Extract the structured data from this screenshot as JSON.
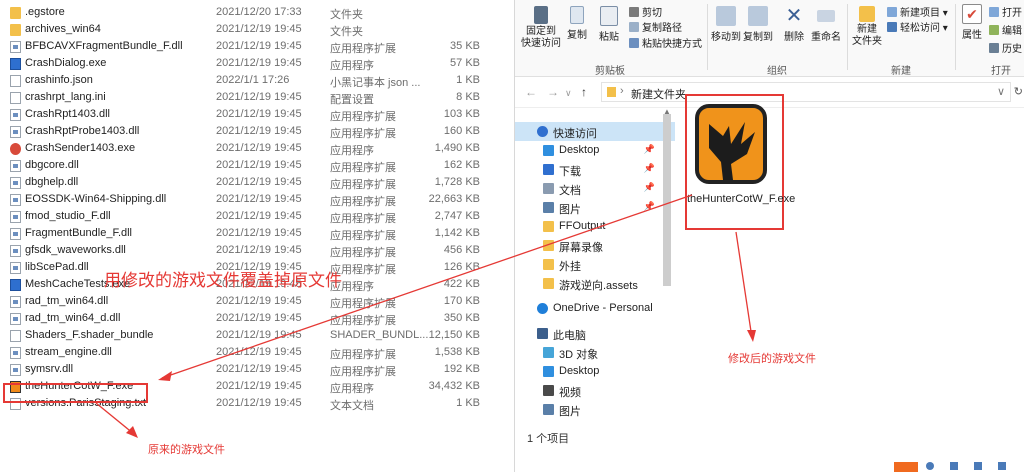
{
  "files": [
    {
      "name": ".egstore",
      "date": "2021/12/20 17:33",
      "type": "文件夹",
      "size": "",
      "icon": "folder"
    },
    {
      "name": "archives_win64",
      "date": "2021/12/19 19:45",
      "type": "文件夹",
      "size": "",
      "icon": "folder"
    },
    {
      "name": "BFBCAVXFragmentBundle_F.dll",
      "date": "2021/12/19 19:45",
      "type": "应用程序扩展",
      "size": "35 KB",
      "icon": "dll"
    },
    {
      "name": "CrashDialog.exe",
      "date": "2021/12/19 19:45",
      "type": "应用程序",
      "size": "57 KB",
      "icon": "exe"
    },
    {
      "name": "crashinfo.json",
      "date": "2022/1/1 17:26",
      "type": "小黑记事本 json ...",
      "size": "1 KB",
      "icon": "json"
    },
    {
      "name": "crashrpt_lang.ini",
      "date": "2021/12/19 19:45",
      "type": "配置设置",
      "size": "8 KB",
      "icon": "ini"
    },
    {
      "name": "CrashRpt1403.dll",
      "date": "2021/12/19 19:45",
      "type": "应用程序扩展",
      "size": "103 KB",
      "icon": "dll"
    },
    {
      "name": "CrashRptProbe1403.dll",
      "date": "2021/12/19 19:45",
      "type": "应用程序扩展",
      "size": "160 KB",
      "icon": "dll"
    },
    {
      "name": "CrashSender1403.exe",
      "date": "2021/12/19 19:45",
      "type": "应用程序",
      "size": "1,490 KB",
      "icon": "sender"
    },
    {
      "name": "dbgcore.dll",
      "date": "2021/12/19 19:45",
      "type": "应用程序扩展",
      "size": "162 KB",
      "icon": "dll"
    },
    {
      "name": "dbghelp.dll",
      "date": "2021/12/19 19:45",
      "type": "应用程序扩展",
      "size": "1,728 KB",
      "icon": "dll"
    },
    {
      "name": "EOSSDK-Win64-Shipping.dll",
      "date": "2021/12/19 19:45",
      "type": "应用程序扩展",
      "size": "22,663 KB",
      "icon": "dll"
    },
    {
      "name": "fmod_studio_F.dll",
      "date": "2021/12/19 19:45",
      "type": "应用程序扩展",
      "size": "2,747 KB",
      "icon": "dll"
    },
    {
      "name": "FragmentBundle_F.dll",
      "date": "2021/12/19 19:45",
      "type": "应用程序扩展",
      "size": "1,142 KB",
      "icon": "dll"
    },
    {
      "name": "gfsdk_waveworks.dll",
      "date": "2021/12/19 19:45",
      "type": "应用程序扩展",
      "size": "456 KB",
      "icon": "dll"
    },
    {
      "name": "libScePad.dll",
      "date": "2021/12/19 19:45",
      "type": "应用程序扩展",
      "size": "126 KB",
      "icon": "dll"
    },
    {
      "name": "MeshCacheTests.exe",
      "date": "2021/12/19 19:45",
      "type": "应用程序",
      "size": "422 KB",
      "icon": "exe"
    },
    {
      "name": "rad_tm_win64.dll",
      "date": "2021/12/19 19:45",
      "type": "应用程序扩展",
      "size": "170 KB",
      "icon": "dll"
    },
    {
      "name": "rad_tm_win64_d.dll",
      "date": "2021/12/19 19:45",
      "type": "应用程序扩展",
      "size": "350 KB",
      "icon": "dll"
    },
    {
      "name": "Shaders_F.shader_bundle",
      "date": "2021/12/19 19:45",
      "type": "SHADER_BUNDL...",
      "size": "12,150 KB",
      "icon": "bundle"
    },
    {
      "name": "stream_engine.dll",
      "date": "2021/12/19 19:45",
      "type": "应用程序扩展",
      "size": "1,538 KB",
      "icon": "dll"
    },
    {
      "name": "symsrv.dll",
      "date": "2021/12/19 19:45",
      "type": "应用程序扩展",
      "size": "192 KB",
      "icon": "dll"
    },
    {
      "name": "theHunterCotW_F.exe",
      "date": "2021/12/19 19:45",
      "type": "应用程序",
      "size": "34,432 KB",
      "icon": "game"
    },
    {
      "name": "versions.ParisStaging.txt",
      "date": "2021/12/19 19:45",
      "type": "文本文档",
      "size": "1 KB",
      "icon": "txt"
    }
  ],
  "annotations": {
    "overwrite": "用修改的游戏文件覆盖掉原文件",
    "original": "原来的游戏文件",
    "modified": "修改后的游戏文件"
  },
  "ribbon": {
    "pin_quick": "固定到\n快速访问",
    "copy": "复制",
    "paste": "粘贴",
    "cut": "剪切",
    "copy_path": "复制路径",
    "paste_shortcut": "粘贴快捷方式",
    "move_to": "移动到",
    "copy_to": "复制到",
    "delete": "删除",
    "rename": "重命名",
    "new_folder": "新建\n文件夹",
    "new_item": "新建项目",
    "easy_access": "轻松访问",
    "properties": "属性",
    "open": "打开",
    "edit": "编辑",
    "history": "历史",
    "group_clipboard": "剪贴板",
    "group_organize": "组织",
    "group_new": "新建",
    "group_open": "打开"
  },
  "address": {
    "path": "新建文件夹"
  },
  "nav": [
    {
      "label": "快速访问",
      "kind": "star",
      "sel": true,
      "pin": false
    },
    {
      "label": "Desktop",
      "kind": "blue",
      "sel": false,
      "pin": true
    },
    {
      "label": "下载",
      "kind": "down",
      "sel": false,
      "pin": true
    },
    {
      "label": "文档",
      "kind": "doc",
      "sel": false,
      "pin": true
    },
    {
      "label": "图片",
      "kind": "pic",
      "sel": false,
      "pin": true
    },
    {
      "label": "FFOutput",
      "kind": "folder",
      "sel": false,
      "pin": false
    },
    {
      "label": "屏幕录像",
      "kind": "folder",
      "sel": false,
      "pin": false
    },
    {
      "label": "外挂",
      "kind": "folder",
      "sel": false,
      "pin": false
    },
    {
      "label": "游戏逆向.assets",
      "kind": "folder",
      "sel": false,
      "pin": false
    },
    {
      "label": "OneDrive - Personal",
      "kind": "cloud",
      "sel": false,
      "pin": false
    },
    {
      "label": "此电脑",
      "kind": "pc",
      "sel": false,
      "pin": false
    },
    {
      "label": "3D 对象",
      "kind": "cube",
      "sel": false,
      "pin": false
    },
    {
      "label": "Desktop",
      "kind": "blue",
      "sel": false,
      "pin": false
    },
    {
      "label": "视频",
      "kind": "video",
      "sel": false,
      "pin": false
    },
    {
      "label": "图片",
      "kind": "pic",
      "sel": false,
      "pin": false
    }
  ],
  "content": {
    "item_name": "theHunterCotW_F.exe"
  },
  "status": {
    "count": "1 个项目"
  },
  "colors": {
    "accent_red": "#e53935",
    "folder": "#f3c04a",
    "select": "#cce4f7"
  }
}
